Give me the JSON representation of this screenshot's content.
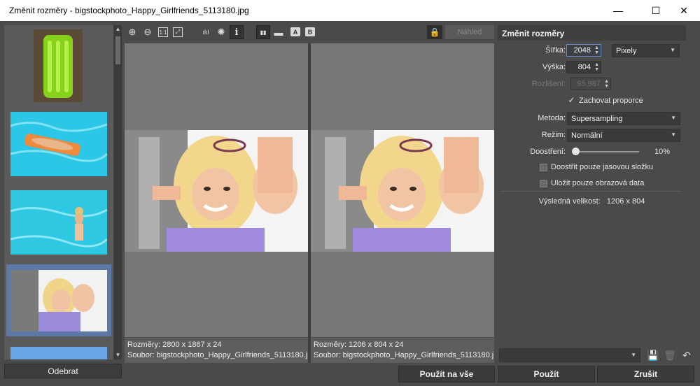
{
  "window": {
    "title": "Změnit rozměry - bigstockphoto_Happy_Girlfriends_5113180.jpg",
    "minimize": "—",
    "maximize": "☐",
    "close": "✕"
  },
  "toolbar": {
    "zoom_in": "⊕",
    "zoom_out": "⊖",
    "actual_size": "1:1",
    "fit": "⤢",
    "histogram": "ılıl",
    "brightness": "✺",
    "info": "ℹ",
    "split_vertical": "▮▮",
    "split_horizontal": "▬",
    "view_a": "A",
    "view_b": "B",
    "lock": "🔒",
    "preview_label": "Náhled"
  },
  "thumbs": {
    "remove_label": "Odebrat",
    "scroll_up": "▲",
    "scroll_down": "▼"
  },
  "preview_left": {
    "dimensions": "Rozměry: 2800 x 1867 x 24",
    "file": "Soubor: bigstockphoto_Happy_Girlfriends_5113180.jp..."
  },
  "preview_right": {
    "dimensions": "Rozměry: 1206 x 804 x 24",
    "file": "Soubor: bigstockphoto_Happy_Girlfriends_5113180.jpg"
  },
  "panel": {
    "header": "Změnit rozměry",
    "width_label": "Šířka:",
    "width_value": "2048",
    "unit": "Pixely",
    "height_label": "Výška:",
    "height_value": "804",
    "resolution_label": "Rozlišení:",
    "resolution_value": "95,987",
    "keep_ratio_label": "Zachovat proporce",
    "keep_ratio_checked": true,
    "method_label": "Metoda:",
    "method_value": "Supersampling",
    "mode_label": "Režim:",
    "mode_value": "Normální",
    "sharpen_label": "Doostření:",
    "sharpen_value": "10%",
    "sharpen_fraction": 0.1,
    "luma_only_label": "Doostřit pouze jasovou složku",
    "image_only_label": "Uložit pouze obrazová data",
    "result_label": "Výsledná velikost:",
    "result_value": "1206 x 804"
  },
  "preset": {
    "save": "💾",
    "delete": "🗑",
    "undo": "↶"
  },
  "buttons": {
    "apply_all": "Použít na vše",
    "apply": "Použít",
    "cancel": "Zrušit"
  },
  "colors": {
    "background": "#4a4a4a",
    "selection": "#5b78a6",
    "preview_bg": "#767676"
  }
}
